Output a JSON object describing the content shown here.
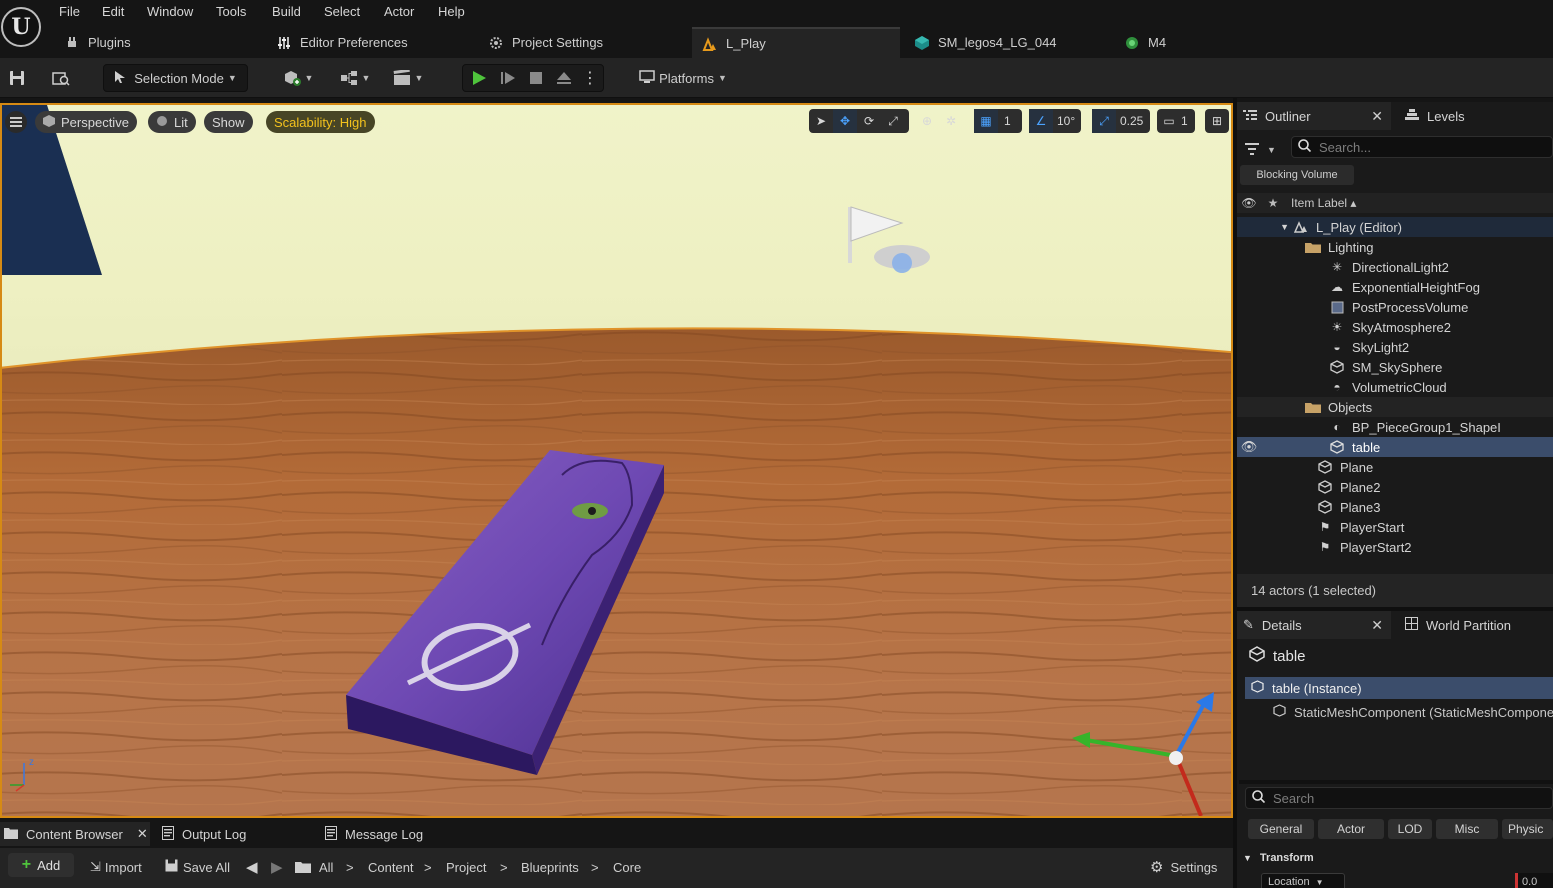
{
  "menubar": {
    "items": [
      "File",
      "Edit",
      "Window",
      "Tools",
      "Build",
      "Select",
      "Actor",
      "Help"
    ]
  },
  "tabs": [
    {
      "label": "Plugins",
      "icon": "plug-icon"
    },
    {
      "label": "Editor Preferences",
      "icon": "sliders-icon"
    },
    {
      "label": "Project Settings",
      "icon": "cubes-gear-icon"
    },
    {
      "label": "L_Play",
      "icon": "level-icon"
    },
    {
      "label": "SM_legos4_LG_044",
      "icon": "static-mesh-icon"
    },
    {
      "label": "M4",
      "icon": "material-icon"
    }
  ],
  "toolbar": {
    "selection_mode": "Selection Mode",
    "platforms": "Platforms"
  },
  "viewport": {
    "perspective": "Perspective",
    "lit": "Lit",
    "show": "Show",
    "scalability": "Scalability: High",
    "grid_value": "1",
    "rotation_snap": "10°",
    "scale_snap": "0.25",
    "camera_speed": "1",
    "axis_z": "z",
    "accent_color": "#d68a14"
  },
  "outliner": {
    "tab_label": "Outliner",
    "levels_label": "Levels",
    "search_placeholder": "Search...",
    "filter_chip": "Blocking Volume",
    "column_header": "Item Label ▴",
    "rows": [
      {
        "label": "L_Play (Editor)",
        "icon": "level-icon"
      },
      {
        "label": "Lighting",
        "icon": "folder-icon"
      },
      {
        "label": "DirectionalLight2",
        "icon": "sun-icon"
      },
      {
        "label": "ExponentialHeightFog",
        "icon": "fog-icon"
      },
      {
        "label": "PostProcessVolume",
        "icon": "volume-icon"
      },
      {
        "label": "SkyAtmosphere2",
        "icon": "atmosphere-icon"
      },
      {
        "label": "SkyLight2",
        "icon": "skylight-icon"
      },
      {
        "label": "SM_SkySphere",
        "icon": "static-mesh-icon"
      },
      {
        "label": "VolumetricCloud",
        "icon": "cloud-icon"
      },
      {
        "label": "Objects",
        "icon": "folder-icon"
      },
      {
        "label": "BP_PieceGroup1_ShapeI",
        "icon": "blueprint-icon"
      },
      {
        "label": "table",
        "icon": "static-mesh-icon"
      },
      {
        "label": "Plane",
        "icon": "static-mesh-icon"
      },
      {
        "label": "Plane2",
        "icon": "static-mesh-icon"
      },
      {
        "label": "Plane3",
        "icon": "static-mesh-icon"
      },
      {
        "label": "PlayerStart",
        "icon": "player-start-icon"
      },
      {
        "label": "PlayerStart2",
        "icon": "player-start-icon"
      }
    ],
    "status": "14 actors (1 selected)"
  },
  "details": {
    "tab_label": "Details",
    "world_partition_label": "World Partition",
    "actor_name": "table",
    "instance_row": "table (Instance)",
    "component_row": "StaticMeshComponent (StaticMeshCompone",
    "search_placeholder": "Search",
    "filters": [
      "General",
      "Actor",
      "LOD",
      "Misc",
      "Physic"
    ],
    "section": "Transform",
    "location_label": "Location",
    "location_value": "0.0"
  },
  "bottom": {
    "tabs": [
      "Content Browser",
      "Output Log",
      "Message Log"
    ],
    "add": "Add",
    "import": "Import",
    "save_all": "Save All",
    "breadcrumb": [
      "All",
      "Content",
      "Project",
      "Blueprints",
      "Core"
    ],
    "settings": "Settings"
  }
}
